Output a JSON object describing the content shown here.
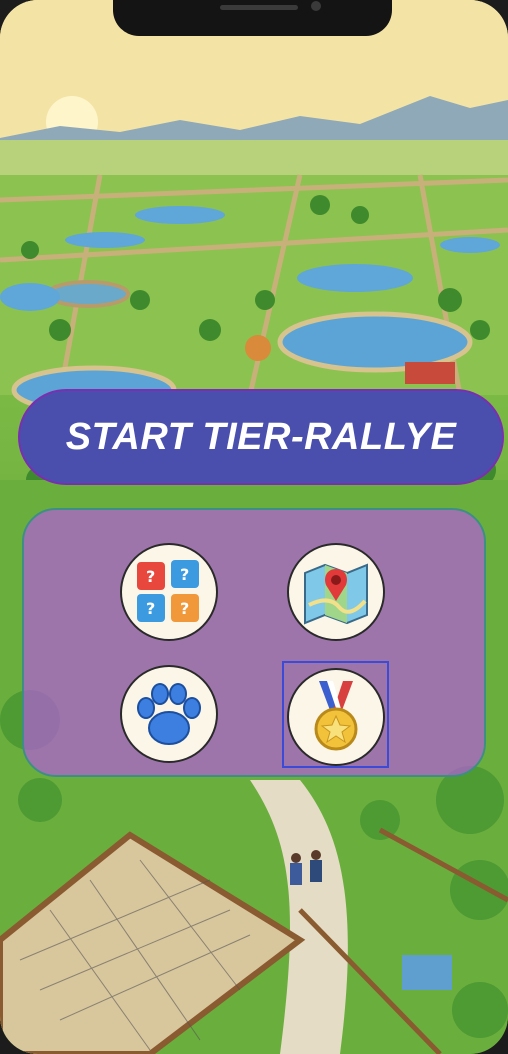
{
  "screen": {
    "start_button_label": "START TIER-RALLYE"
  },
  "menu": {
    "items": [
      {
        "icon": "dice-icon",
        "selected": false
      },
      {
        "icon": "map-icon",
        "selected": false
      },
      {
        "icon": "paw-icon",
        "selected": false
      },
      {
        "icon": "medal-icon",
        "selected": true
      }
    ]
  },
  "colors": {
    "start_button_bg": "#4a4fae",
    "panel_bg": "#b260d6",
    "selection_border": "#3b4bd8"
  }
}
